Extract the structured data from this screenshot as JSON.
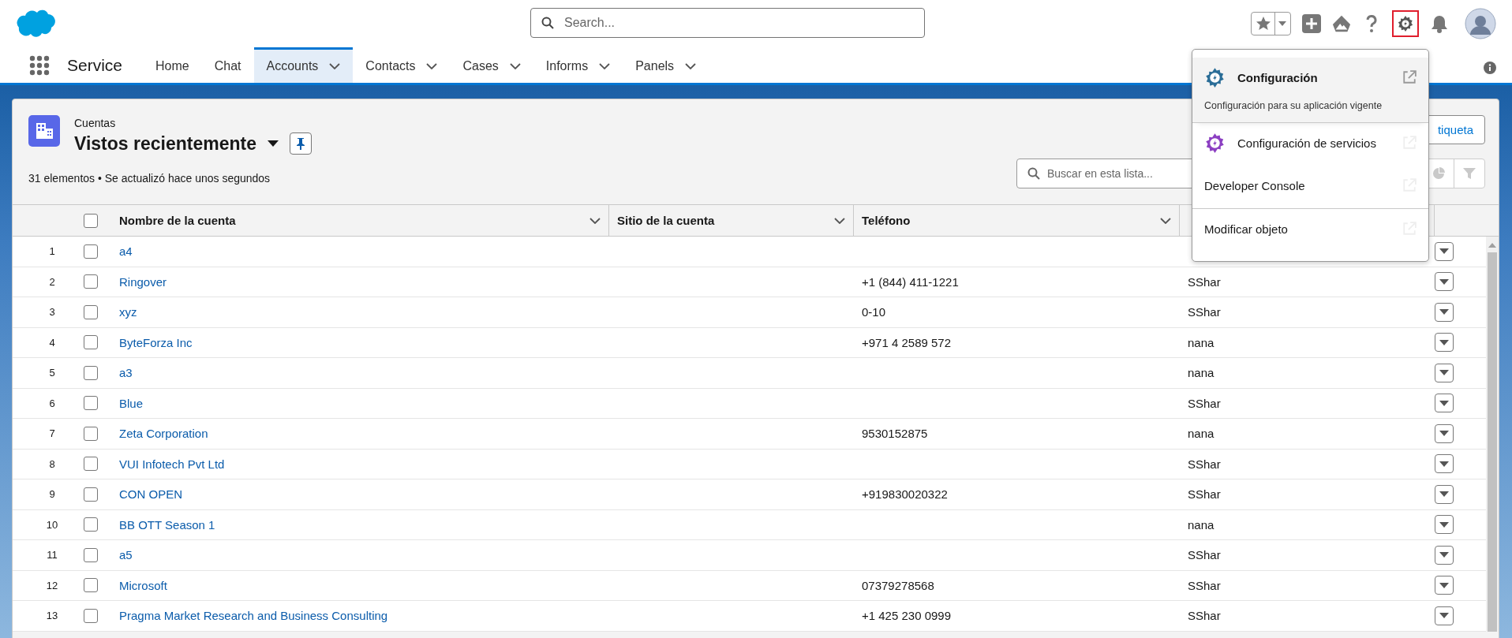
{
  "global_header": {
    "search": {
      "placeholder": "Search..."
    },
    "setup": {
      "selected": true
    }
  },
  "app": {
    "name": "Service"
  },
  "nav_tabs": [
    {
      "label": "Home",
      "menu": false,
      "selected": false
    },
    {
      "label": "Chat",
      "menu": false,
      "selected": false
    },
    {
      "label": "Accounts",
      "menu": true,
      "selected": true
    },
    {
      "label": "Contacts",
      "menu": true,
      "selected": false
    },
    {
      "label": "Cases",
      "menu": true,
      "selected": false
    },
    {
      "label": "Informs",
      "menu": true,
      "selected": false
    },
    {
      "label": "Panels",
      "menu": true,
      "selected": false
    }
  ],
  "list_view": {
    "object": "Cuentas",
    "title": "Vistos recientemente",
    "status": "31 elementos • Se actualizó hace unos segundos",
    "new_button": "tiqueta",
    "search": {
      "placeholder": "Buscar en esta lista..."
    }
  },
  "table": {
    "all_checked": false,
    "columns": [
      {
        "label": "Nombre de la cuenta"
      },
      {
        "label": "Sitio de la cuenta"
      },
      {
        "label": "Teléfono"
      }
    ],
    "rows": [
      {
        "number": "1",
        "name": "a4",
        "checked": false
      },
      {
        "number": "2",
        "name": "Ringover",
        "phone": "+1 (844) 411-1221",
        "owner": "SShar",
        "checked": false
      },
      {
        "number": "3",
        "name": "xyz",
        "phone": "0-10",
        "owner": "SShar",
        "checked": false
      },
      {
        "number": "4",
        "name": "ByteForza Inc",
        "phone": "+971 4 2589 572",
        "owner": "nana",
        "checked": false
      },
      {
        "number": "5",
        "name": "a3",
        "owner": "nana",
        "checked": false
      },
      {
        "number": "6",
        "name": "Blue",
        "owner": "SShar",
        "checked": false
      },
      {
        "number": "7",
        "name": "Zeta Corporation",
        "phone": "9530152875",
        "owner": "nana",
        "checked": false
      },
      {
        "number": "8",
        "name": "VUI Infotech Pvt Ltd",
        "owner": "SShar",
        "checked": false
      },
      {
        "number": "9",
        "name": "CON OPEN",
        "phone": "+919830020322",
        "owner": "SShar",
        "checked": false
      },
      {
        "number": "10",
        "name": "BB OTT Season 1",
        "owner": "nana",
        "checked": false
      },
      {
        "number": "11",
        "name": "a5",
        "owner": "SShar",
        "checked": false
      },
      {
        "number": "12",
        "name": "Microsoft",
        "phone": "07379278568",
        "owner": "SShar",
        "checked": false
      },
      {
        "number": "13",
        "name": "Pragma Market Research and Business Consulting",
        "phone": "+1 425 230 0999",
        "owner": "SShar",
        "checked": false
      }
    ]
  },
  "setup_menu": {
    "items": [
      {
        "kind": "setup",
        "label": "Configuración",
        "description": "Configuración para su aplicación vigente",
        "selected": true
      },
      {
        "kind": "service",
        "label": "Configuración de servicios",
        "selected": false
      },
      {
        "kind": "plain",
        "label": "Developer Console",
        "selected": false
      },
      {
        "kind": "plain",
        "label": "Modificar objeto",
        "selected": false,
        "divider_before": true
      }
    ]
  }
}
